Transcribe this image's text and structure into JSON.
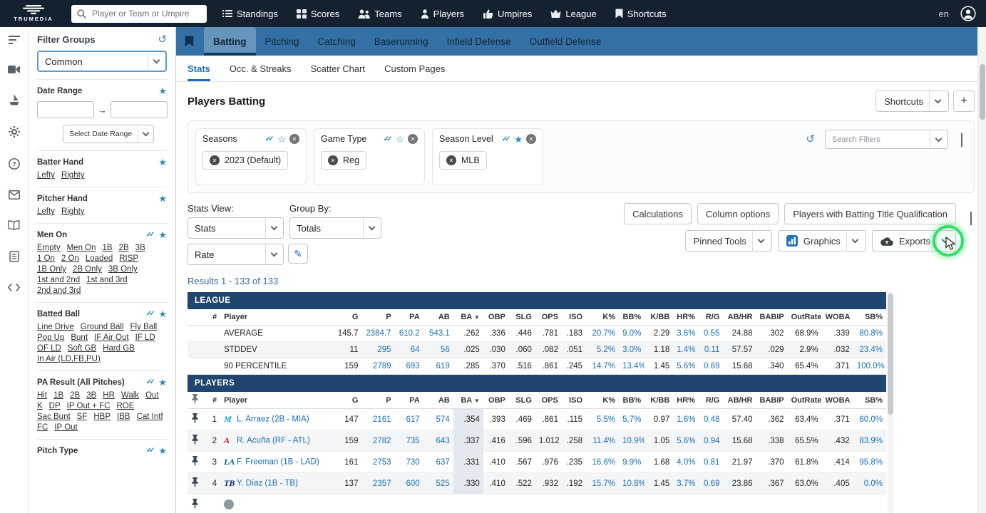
{
  "colors": {
    "accent_blue": "#1a6fba",
    "band_blue": "#3470a5",
    "table_header_blue": "#20456e",
    "highlight_green": "#2fe066"
  },
  "topbar": {
    "brand": "TRUMEDIA",
    "search_placeholder": "Player or Team or Umpire",
    "nav": [
      {
        "label": "Standings",
        "icon": "standings-icon"
      },
      {
        "label": "Scores",
        "icon": "scores-icon"
      },
      {
        "label": "Teams",
        "icon": "teams-icon"
      },
      {
        "label": "Players",
        "icon": "players-icon"
      },
      {
        "label": "Umpires",
        "icon": "umpires-icon"
      },
      {
        "label": "League",
        "icon": "league-icon"
      },
      {
        "label": "Shortcuts",
        "icon": "bookmark-icon"
      }
    ],
    "language": "en"
  },
  "icon_rail": [
    "filter-icon",
    "video-icon",
    "ship-icon",
    "gear-icon",
    "help-icon",
    "mail-icon",
    "book-icon",
    "journal-icon",
    "code-icon"
  ],
  "filter_panel": {
    "title": "Filter Groups",
    "group_select_value": "Common",
    "date_range": {
      "label": "Date Range",
      "from_value": "",
      "to_value": "",
      "select_label": "Select Date Range"
    },
    "sections": [
      {
        "name": "Batter Hand",
        "multi": false,
        "links": [
          "Lefty",
          "Righty"
        ]
      },
      {
        "name": "Pitcher Hand",
        "multi": false,
        "links": [
          "Lefty",
          "Righty"
        ]
      },
      {
        "name": "Men On",
        "multi": true,
        "links": [
          "Empty",
          "Men On",
          "1B",
          "2B",
          "3B",
          "1 On",
          "2 On",
          "Loaded",
          "RISP",
          "1B Only",
          "2B Only",
          "3B Only",
          "1st and 2nd",
          "1st and 3rd",
          "2nd and 3rd"
        ]
      },
      {
        "name": "Batted Ball",
        "multi": true,
        "links": [
          "Line Drive",
          "Ground Ball",
          "Fly Ball",
          "Pop Up",
          "Bunt",
          "IF Air Out",
          "IF LD",
          "OF LD",
          "Soft GB",
          "Hard GB",
          "In Air (LD,FB,PU)"
        ]
      },
      {
        "name": "PA Result (All Pitches)",
        "multi": true,
        "links": [
          "Hit",
          "1B",
          "2B",
          "3B",
          "HR",
          "Walk",
          "Out",
          "K",
          "DP",
          "IP Out + FC",
          "ROE",
          "Sac Bunt",
          "SF",
          "HBP",
          "IBB",
          "Cat Intf",
          "FC",
          "IP Out"
        ]
      },
      {
        "name": "Pitch Type",
        "multi": true,
        "links": []
      }
    ]
  },
  "main_tabs": {
    "active": "Batting",
    "items": [
      "Batting",
      "Pitching",
      "Catching",
      "Baserunning",
      "Infield Defense",
      "Outfield Defense"
    ]
  },
  "sub_tabs": {
    "active": "Stats",
    "items": [
      "Stats",
      "Occ. & Streaks",
      "Scatter Chart",
      "Custom Pages"
    ]
  },
  "page": {
    "title": "Players Batting",
    "shortcuts_button": "Shortcuts",
    "add_button": "+"
  },
  "active_filters": {
    "groups": [
      {
        "label": "Seasons",
        "chip": "2023 (Default)",
        "starred": false
      },
      {
        "label": "Game Type",
        "chip": "Reg",
        "starred": false
      },
      {
        "label": "Season Level",
        "chip": "MLB",
        "starred": true
      }
    ],
    "search_placeholder": "Search Filters"
  },
  "stats_view": {
    "label": "Stats View:",
    "value": "Stats",
    "group_by_label": "Group By:",
    "group_by_value": "Totals",
    "rate_value": "Rate"
  },
  "toolbar": {
    "row1": [
      "Calculations",
      "Column options",
      "Players with Batting Title Qualification"
    ],
    "row2": [
      {
        "label": "Pinned Tools",
        "icon": "",
        "highlighted": false
      },
      {
        "label": "Graphics",
        "icon": "bar-chart-icon",
        "highlighted": false
      },
      {
        "label": "Exports",
        "icon": "cloud-icon",
        "highlighted": true
      }
    ]
  },
  "results_text": "Results 1 - 133 of 133",
  "table": {
    "columns": [
      "#",
      "Player",
      "G",
      "P",
      "PA",
      "AB",
      "BA",
      "OBP",
      "SLG",
      "OPS",
      "ISO",
      "K%",
      "BB%",
      "K/BB",
      "HR%",
      "R/G",
      "AB/HR",
      "BABIP",
      "OutRate",
      "WOBA",
      "SB%"
    ],
    "sorted_column": "BA",
    "league": {
      "title": "LEAGUE",
      "rows": [
        {
          "label": "AVERAGE",
          "values": [
            "145.7",
            "2384.7",
            "610.2",
            "543.1",
            ".262",
            ".336",
            ".446",
            ".781",
            ".183",
            "20.7%",
            "9.0%",
            "2.29",
            "3.6%",
            "0.55",
            "24.88",
            ".302",
            "68.9%",
            ".339",
            "80.8%"
          ]
        },
        {
          "label": "STDDEV",
          "values": [
            "11",
            "295",
            "64",
            "56",
            ".025",
            ".030",
            ".060",
            ".082",
            ".051",
            "5.2%",
            "3.0%",
            "1.18",
            "1.4%",
            "0.11",
            "57.57",
            ".029",
            "2.9%",
            ".032",
            "23.4%"
          ]
        },
        {
          "label": "90 PERCENTILE",
          "values": [
            "159",
            "2789",
            "693",
            "619",
            ".285",
            ".370",
            ".516",
            ".861",
            ".245",
            "14.7%",
            "13.4%",
            "1.45",
            "5.6%",
            "0.69",
            "15.68",
            ".340",
            "65.4%",
            ".371",
            "100.0%"
          ]
        }
      ]
    },
    "players": {
      "title": "PLAYERS",
      "rows": [
        {
          "rank": "1",
          "team": "MIA",
          "name": "L. Arraez (2B - MIA)",
          "values": [
            "147",
            "2161",
            "617",
            "574",
            ".354",
            ".393",
            ".469",
            ".861",
            ".115",
            "5.5%",
            "5.7%",
            "0.97",
            "1.6%",
            "0.48",
            "57.40",
            ".362",
            "63.4%",
            ".371",
            "60.0%"
          ]
        },
        {
          "rank": "2",
          "team": "ATL",
          "name": "R. Acuña (RF - ATL)",
          "values": [
            "159",
            "2782",
            "735",
            "643",
            ".337",
            ".416",
            ".596",
            "1.012",
            ".258",
            "11.4%",
            "10.9%",
            "1.05",
            "5.6%",
            "0.94",
            "15.68",
            ".338",
            "65.5%",
            ".432",
            "83.9%"
          ]
        },
        {
          "rank": "3",
          "team": "LAD",
          "name": "F. Freeman (1B - LAD)",
          "values": [
            "161",
            "2753",
            "730",
            "637",
            ".331",
            ".410",
            ".567",
            ".976",
            ".235",
            "16.6%",
            "9.9%",
            "1.68",
            "4.0%",
            "0.81",
            "21.97",
            ".370",
            "61.8%",
            ".414",
            "95.8%"
          ]
        },
        {
          "rank": "4",
          "team": "TB",
          "name": "Y. Díaz (1B - TB)",
          "values": [
            "137",
            "2357",
            "600",
            "525",
            ".330",
            ".410",
            ".522",
            ".932",
            ".192",
            "15.7%",
            "10.8%",
            "1.45",
            "3.7%",
            "0.69",
            "23.86",
            ".367",
            "63.0%",
            ".405",
            "0.0%"
          ]
        }
      ]
    }
  }
}
